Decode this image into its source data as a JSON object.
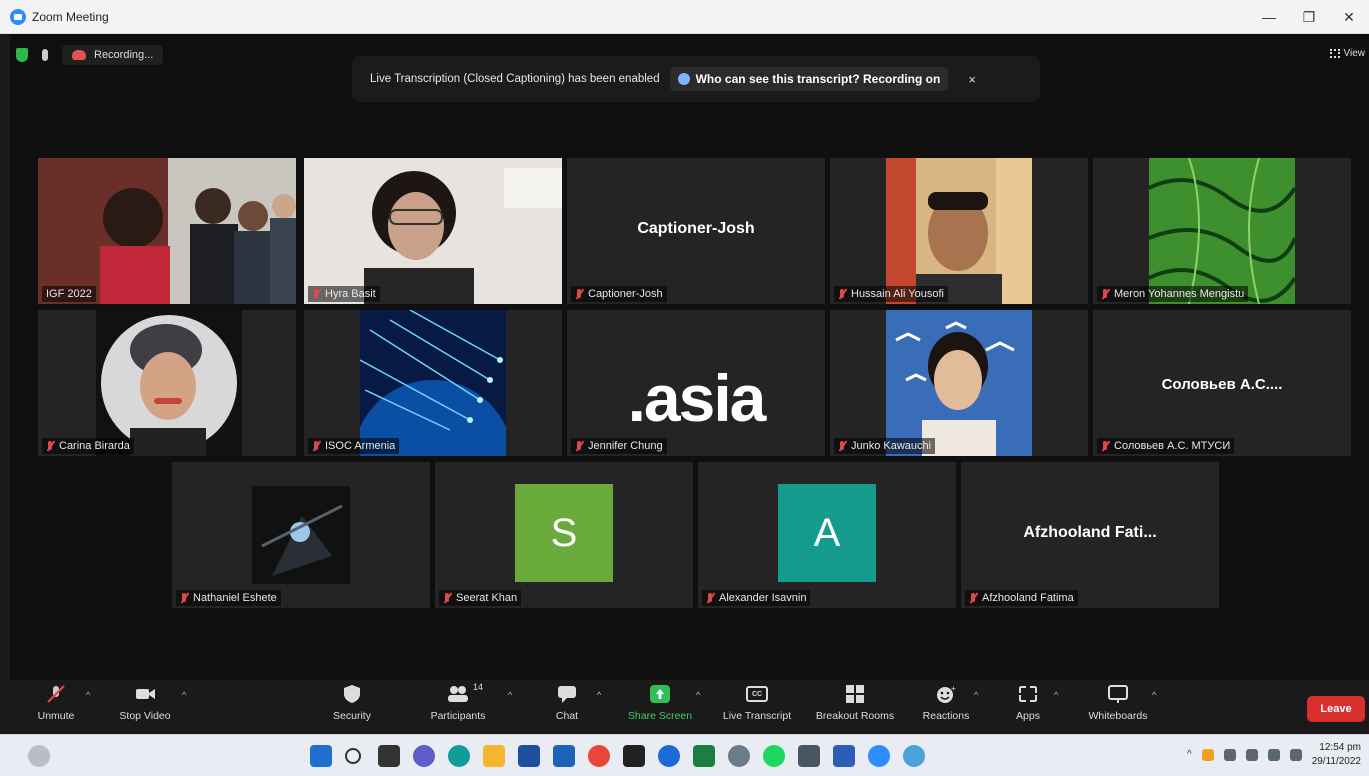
{
  "window": {
    "title": "Zoom Meeting",
    "minimize": "—",
    "maximize": "❐",
    "close": "✕"
  },
  "topbar": {
    "recording_label": "Recording...",
    "view_label": "View"
  },
  "banner": {
    "message": "Live Transcription (Closed Captioning) has been enabled",
    "who_label": "Who can see this transcript? Recording on",
    "close": "×"
  },
  "tiles": [
    {
      "name": "IGF 2022",
      "display": "",
      "active": true
    },
    {
      "name": "Hyra Basit",
      "display": ""
    },
    {
      "name": "Captioner-Josh",
      "display": "Captioner-Josh"
    },
    {
      "name": "Hussain Ali Yousofi",
      "display": ""
    },
    {
      "name": "Meron Yohannes Mengistu",
      "display": ""
    },
    {
      "name": "Carina Birarda",
      "display": ""
    },
    {
      "name": "ISOC Armenia",
      "display": ""
    },
    {
      "name": "Jennifer Chung",
      "display": ".asia"
    },
    {
      "name": "Junko Kawauchi",
      "display": ""
    },
    {
      "name": "Соловьев А.С. МТУСИ",
      "display": "Соловьев А.С...."
    },
    {
      "name": "Nathaniel Eshete",
      "display": ""
    },
    {
      "name": "Seerat Khan",
      "display": "S"
    },
    {
      "name": "Alexander Isavnin",
      "display": "A"
    },
    {
      "name": "Afzhooland Fatima",
      "display": "Afzhooland Fati..."
    }
  ],
  "toolbar": {
    "unmute": "Unmute",
    "stop_video": "Stop Video",
    "security": "Security",
    "participants": "Participants",
    "participants_count": "14",
    "chat": "Chat",
    "share_screen": "Share Screen",
    "live_transcript": "Live Transcript",
    "live_transcript_icon": "CC",
    "breakout_rooms": "Breakout Rooms",
    "reactions": "Reactions",
    "apps": "Apps",
    "whiteboards": "Whiteboards",
    "leave": "Leave"
  },
  "taskbar": {
    "time": "12:54 pm",
    "date": "29/11/2022"
  },
  "colors": {
    "active_border": "#e8e46a",
    "share_green": "#3fcf5d",
    "leave_red": "#d8302f",
    "seerat_avatar": "#6aaa3a",
    "alexander_avatar": "#159b8c"
  }
}
